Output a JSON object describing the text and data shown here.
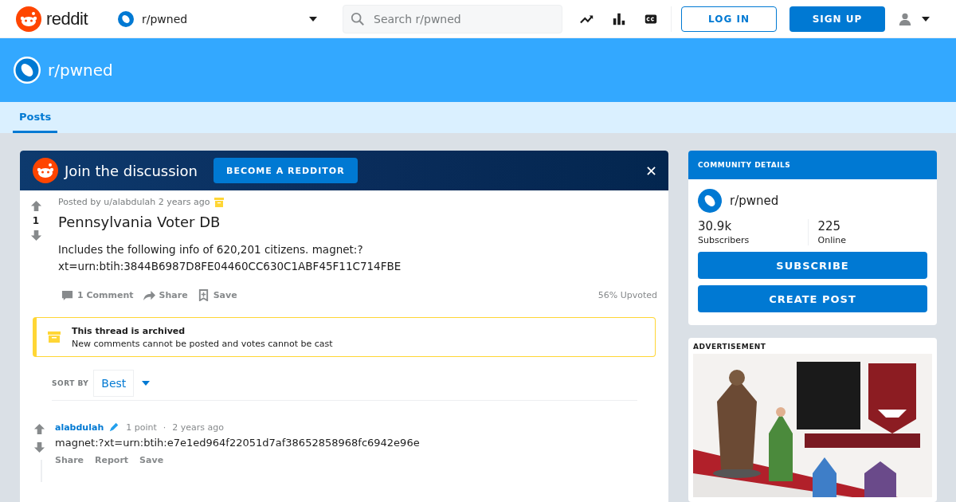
{
  "header": {
    "logo_text": "reddit",
    "community": "r/pwned",
    "search_placeholder": "Search r/pwned",
    "login": "LOG IN",
    "signup": "SIGN UP"
  },
  "banner": {
    "title": "r/pwned"
  },
  "tabs": [
    {
      "label": "Posts",
      "selected": true
    }
  ],
  "join": {
    "title": "Join the discussion",
    "button": "BECOME A REDDITOR"
  },
  "post": {
    "meta": "Posted by u/alabdulah 2 years ago",
    "archived": true,
    "score": "1",
    "title": "Pennsylvania Voter DB",
    "body": [
      "Includes the following info of 620,201 citizens. magnet:?",
      "xt=urn:btih:3844B6987D8FE04460CC630C1ABF45F11C714FBE"
    ],
    "actions": [
      {
        "kind": "comment",
        "label": "1 Comment"
      },
      {
        "kind": "share",
        "label": "Share"
      },
      {
        "kind": "save",
        "label": "Save"
      }
    ],
    "upvoted": "56% Upvoted"
  },
  "notice": {
    "title": "This thread is archived",
    "text": "New comments cannot be posted and votes cannot be cast"
  },
  "sort": {
    "label": "SORT BY",
    "value": "Best"
  },
  "comments": [
    {
      "author": "alabdulah",
      "points": "1 point",
      "separator": "·",
      "time": "2 years ago",
      "text": "magnet:?xt=urn:btih:e7e1ed964f22051d7af38652858968fc6942e96e",
      "actions": [
        "Share",
        "Report",
        "Save"
      ]
    }
  ],
  "community": {
    "header": "COMMUNITY DETAILS",
    "name": "r/pwned",
    "stats": [
      {
        "value": "30.9k",
        "label": "Subscribers"
      },
      {
        "value": "225",
        "label": "Online"
      }
    ],
    "buttons": [
      "SUBSCRIBE",
      "CREATE POST"
    ]
  },
  "advertisement": {
    "label": "ADVERTISEMENT",
    "kind": "picture"
  }
}
